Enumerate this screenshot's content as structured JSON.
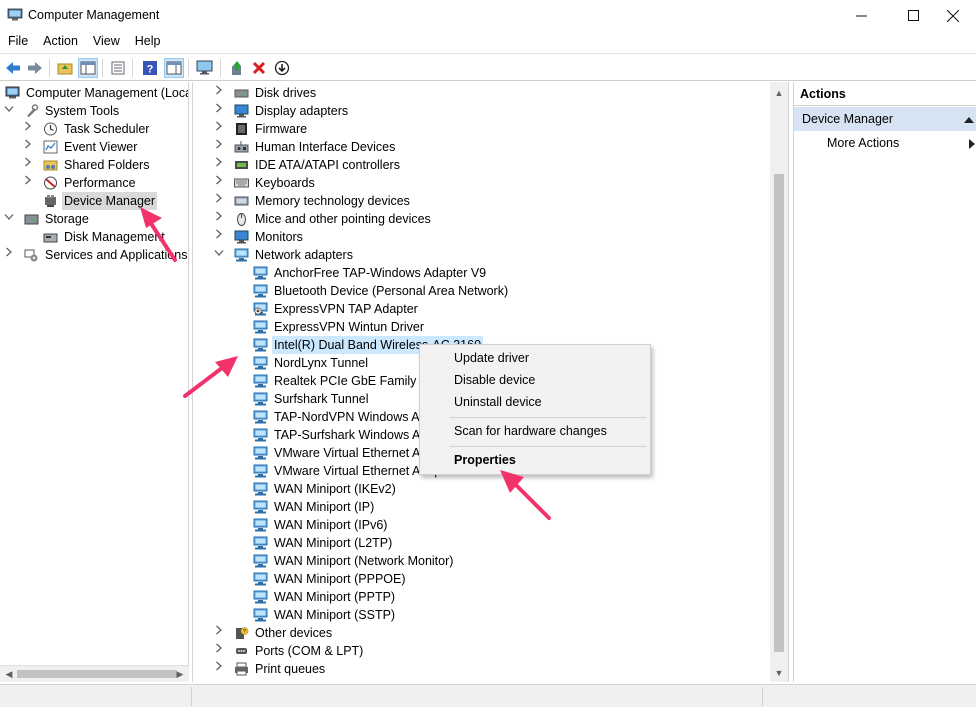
{
  "window": {
    "title": "Computer Management"
  },
  "menu": [
    "File",
    "Action",
    "View",
    "Help"
  ],
  "left_tree": [
    {
      "label": "Computer Management (Local",
      "icon": "computer-management-icon",
      "expander": "",
      "indent": 0
    },
    {
      "label": "System Tools",
      "icon": "system-tools-icon",
      "expander": "v",
      "indent": 1
    },
    {
      "label": "Task Scheduler",
      "icon": "clock-icon",
      "expander": ">",
      "indent": 2
    },
    {
      "label": "Event Viewer",
      "icon": "event-viewer-icon",
      "expander": ">",
      "indent": 2
    },
    {
      "label": "Shared Folders",
      "icon": "shared-folder-icon",
      "expander": ">",
      "indent": 2
    },
    {
      "label": "Performance",
      "icon": "performance-icon",
      "expander": ">",
      "indent": 2
    },
    {
      "label": "Device Manager",
      "icon": "device-manager-icon",
      "expander": "",
      "indent": 2,
      "selected": true
    },
    {
      "label": "Storage",
      "icon": "storage-icon",
      "expander": "v",
      "indent": 1
    },
    {
      "label": "Disk Management",
      "icon": "disk-management-icon",
      "expander": "",
      "indent": 2
    },
    {
      "label": "Services and Applications",
      "icon": "services-icon",
      "expander": ">",
      "indent": 1
    }
  ],
  "device_tree": [
    {
      "label": "Disk drives",
      "icon": "disk-icon",
      "expander": ">",
      "indent": 0
    },
    {
      "label": "Display adapters",
      "icon": "monitor-icon",
      "expander": ">",
      "indent": 0
    },
    {
      "label": "Firmware",
      "icon": "firmware-icon",
      "expander": ">",
      "indent": 0
    },
    {
      "label": "Human Interface Devices",
      "icon": "hid-icon",
      "expander": ">",
      "indent": 0
    },
    {
      "label": "IDE ATA/ATAPI controllers",
      "icon": "ide-icon",
      "expander": ">",
      "indent": 0
    },
    {
      "label": "Keyboards",
      "icon": "keyboard-icon",
      "expander": ">",
      "indent": 0
    },
    {
      "label": "Memory technology devices",
      "icon": "memory-icon",
      "expander": ">",
      "indent": 0
    },
    {
      "label": "Mice and other pointing devices",
      "icon": "mouse-icon",
      "expander": ">",
      "indent": 0
    },
    {
      "label": "Monitors",
      "icon": "monitor-icon",
      "expander": ">",
      "indent": 0
    },
    {
      "label": "Network adapters",
      "icon": "network-adapter-icon",
      "expander": "v",
      "indent": 0
    },
    {
      "label": "AnchorFree TAP-Windows Adapter V9",
      "icon": "network-adapter-icon",
      "expander": "",
      "indent": 1
    },
    {
      "label": "Bluetooth Device (Personal Area Network)",
      "icon": "network-adapter-icon",
      "expander": "",
      "indent": 1
    },
    {
      "label": "ExpressVPN TAP Adapter",
      "icon": "network-adapter-warning-icon",
      "expander": "",
      "indent": 1
    },
    {
      "label": "ExpressVPN Wintun Driver",
      "icon": "network-adapter-icon",
      "expander": "",
      "indent": 1
    },
    {
      "label": "Intel(R) Dual Band Wireless-AC 3160",
      "icon": "network-adapter-icon",
      "expander": "",
      "indent": 1,
      "highlighted": true
    },
    {
      "label": "NordLynx Tunnel",
      "icon": "network-adapter-icon",
      "expander": "",
      "indent": 1
    },
    {
      "label": "Realtek PCIe GbE Family Co",
      "icon": "network-adapter-icon",
      "expander": "",
      "indent": 1
    },
    {
      "label": "Surfshark Tunnel",
      "icon": "network-adapter-icon",
      "expander": "",
      "indent": 1
    },
    {
      "label": "TAP-NordVPN Windows Ad",
      "icon": "network-adapter-icon",
      "expander": "",
      "indent": 1
    },
    {
      "label": "TAP-Surfshark Windows Ad",
      "icon": "network-adapter-icon",
      "expander": "",
      "indent": 1
    },
    {
      "label": "VMware Virtual Ethernet Ad",
      "icon": "network-adapter-icon",
      "expander": "",
      "indent": 1
    },
    {
      "label": "VMware Virtual Ethernet Adapter for VMnet",
      "icon": "network-adapter-icon",
      "expander": "",
      "indent": 1
    },
    {
      "label": "WAN Miniport (IKEv2)",
      "icon": "network-adapter-icon",
      "expander": "",
      "indent": 1
    },
    {
      "label": "WAN Miniport (IP)",
      "icon": "network-adapter-icon",
      "expander": "",
      "indent": 1
    },
    {
      "label": "WAN Miniport (IPv6)",
      "icon": "network-adapter-icon",
      "expander": "",
      "indent": 1
    },
    {
      "label": "WAN Miniport (L2TP)",
      "icon": "network-adapter-icon",
      "expander": "",
      "indent": 1
    },
    {
      "label": "WAN Miniport (Network Monitor)",
      "icon": "network-adapter-icon",
      "expander": "",
      "indent": 1
    },
    {
      "label": "WAN Miniport (PPPOE)",
      "icon": "network-adapter-icon",
      "expander": "",
      "indent": 1
    },
    {
      "label": "WAN Miniport (PPTP)",
      "icon": "network-adapter-icon",
      "expander": "",
      "indent": 1
    },
    {
      "label": "WAN Miniport (SSTP)",
      "icon": "network-adapter-icon",
      "expander": "",
      "indent": 1
    },
    {
      "label": "Other devices",
      "icon": "other-devices-icon",
      "expander": ">",
      "indent": 0
    },
    {
      "label": "Ports (COM & LPT)",
      "icon": "port-icon",
      "expander": ">",
      "indent": 0
    },
    {
      "label": "Print queues",
      "icon": "printer-icon",
      "expander": ">",
      "indent": 0
    }
  ],
  "actions": {
    "header": "Actions",
    "section": "Device Manager",
    "items": [
      "More Actions"
    ]
  },
  "context_menu": {
    "items": [
      "Update driver",
      "Disable device",
      "Uninstall device",
      "Scan for hardware changes",
      "Properties"
    ]
  },
  "colors": {
    "annotation_arrow": "#f2336b",
    "actions_section_bg": "#d5e3f2",
    "highlight_bg": "#cce8ff"
  }
}
